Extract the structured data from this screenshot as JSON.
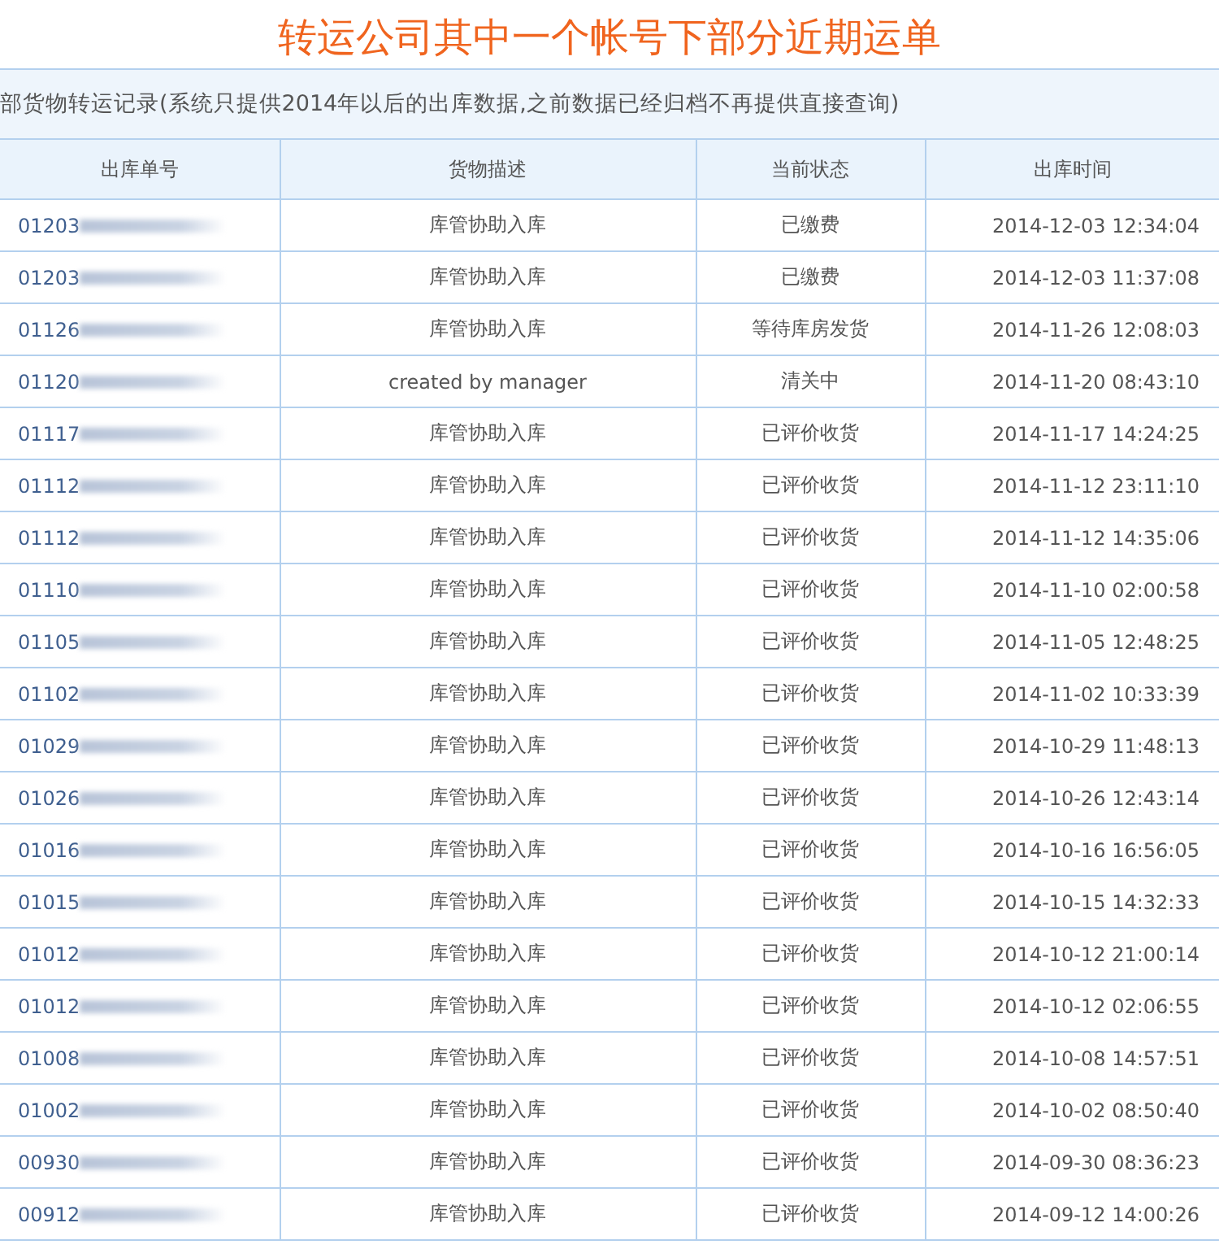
{
  "title": "转运公司其中一个帐号下部分近期运单",
  "subtitle": "部货物转运记录(系统只提供2014年以后的出库数据,之前数据已经归档不再提供直接查询)",
  "table": {
    "columns": [
      "出库单号",
      "货物描述",
      "当前状态",
      "出库时间"
    ],
    "rows": [
      {
        "id": "01203",
        "description": "库管协助入库",
        "status": "已缴费",
        "time": "2014-12-03 12:34:04"
      },
      {
        "id": "01203",
        "description": "库管协助入库",
        "status": "已缴费",
        "time": "2014-12-03 11:37:08"
      },
      {
        "id": "01126",
        "description": "库管协助入库",
        "status": "等待库房发货",
        "time": "2014-11-26 12:08:03"
      },
      {
        "id": "01120",
        "description": "created by manager",
        "status": "清关中",
        "time": "2014-11-20 08:43:10"
      },
      {
        "id": "01117",
        "description": "库管协助入库",
        "status": "已评价收货",
        "time": "2014-11-17 14:24:25"
      },
      {
        "id": "01112",
        "description": "库管协助入库",
        "status": "已评价收货",
        "time": "2014-11-12 23:11:10"
      },
      {
        "id": "01112",
        "description": "库管协助入库",
        "status": "已评价收货",
        "time": "2014-11-12 14:35:06"
      },
      {
        "id": "01110",
        "description": "库管协助入库",
        "status": "已评价收货",
        "time": "2014-11-10 02:00:58"
      },
      {
        "id": "01105",
        "description": "库管协助入库",
        "status": "已评价收货",
        "time": "2014-11-05 12:48:25"
      },
      {
        "id": "01102",
        "description": "库管协助入库",
        "status": "已评价收货",
        "time": "2014-11-02 10:33:39"
      },
      {
        "id": "01029",
        "description": "库管协助入库",
        "status": "已评价收货",
        "time": "2014-10-29 11:48:13"
      },
      {
        "id": "01026",
        "description": "库管协助入库",
        "status": "已评价收货",
        "time": "2014-10-26 12:43:14"
      },
      {
        "id": "01016",
        "description": "库管协助入库",
        "status": "已评价收货",
        "time": "2014-10-16 16:56:05"
      },
      {
        "id": "01015",
        "description": "库管协助入库",
        "status": "已评价收货",
        "time": "2014-10-15 14:32:33"
      },
      {
        "id": "01012",
        "description": "库管协助入库",
        "status": "已评价收货",
        "time": "2014-10-12 21:00:14"
      },
      {
        "id": "01012",
        "description": "库管协助入库",
        "status": "已评价收货",
        "time": "2014-10-12 02:06:55"
      },
      {
        "id": "01008",
        "description": "库管协助入库",
        "status": "已评价收货",
        "time": "2014-10-08 14:57:51"
      },
      {
        "id": "01002",
        "description": "库管协助入库",
        "status": "已评价收货",
        "time": "2014-10-02 08:50:40"
      },
      {
        "id": "00930",
        "description": "库管协助入库",
        "status": "已评价收货",
        "time": "2014-09-30 08:36:23"
      },
      {
        "id": "00912",
        "description": "库管协助入库",
        "status": "已评价收货",
        "time": "2014-09-12 14:00:26"
      }
    ]
  }
}
